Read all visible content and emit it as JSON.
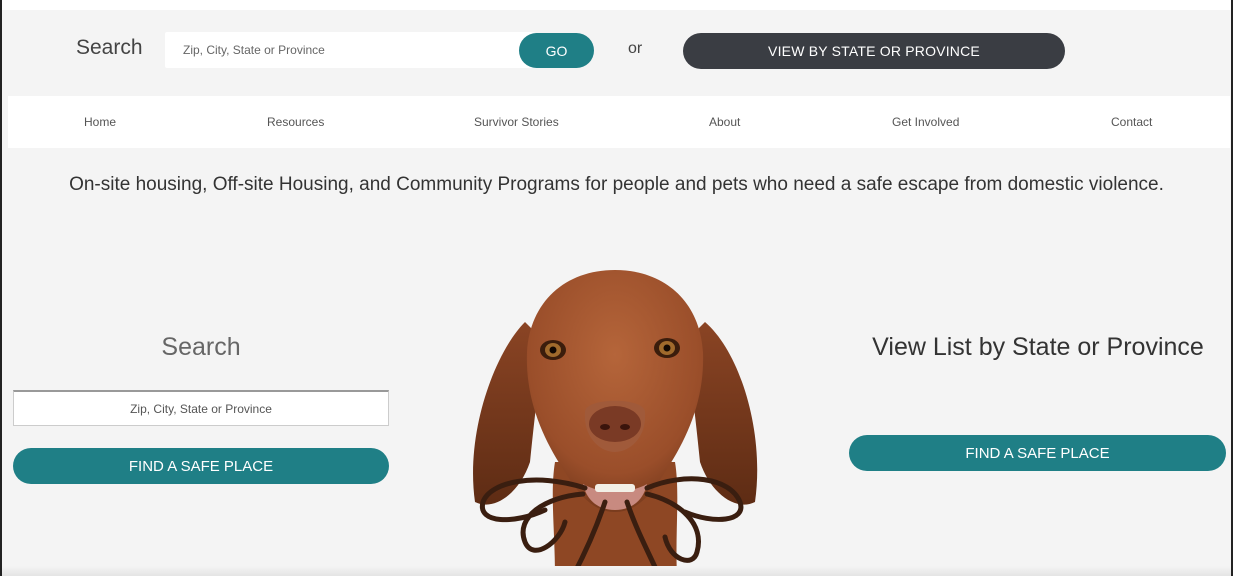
{
  "header": {
    "search_label": "Search",
    "search_placeholder": "Zip, City, State or Province",
    "go_label": "GO",
    "or_label": "or",
    "view_state_label": "VIEW BY STATE OR PROVINCE"
  },
  "nav": {
    "items": [
      {
        "label": "Home"
      },
      {
        "label": "Resources"
      },
      {
        "label": "Survivor Stories"
      },
      {
        "label": "About"
      },
      {
        "label": "Get Involved"
      },
      {
        "label": "Contact"
      }
    ]
  },
  "tagline": "On-site housing, Off-site Housing, and Community Programs for people and pets who need a safe escape from domestic violence.",
  "left_panel": {
    "title": "Search",
    "input_placeholder": "Zip, City, State or Province",
    "button_label": "FIND A SAFE PLACE"
  },
  "right_panel": {
    "title": "View List by State or Province",
    "button_label": "FIND A SAFE PLACE"
  },
  "colors": {
    "accent": "#1f7f86",
    "dark_button": "#3a3d43",
    "background": "#f4f4f4"
  },
  "icons": {
    "hero_image": "dog-with-leash-image"
  }
}
